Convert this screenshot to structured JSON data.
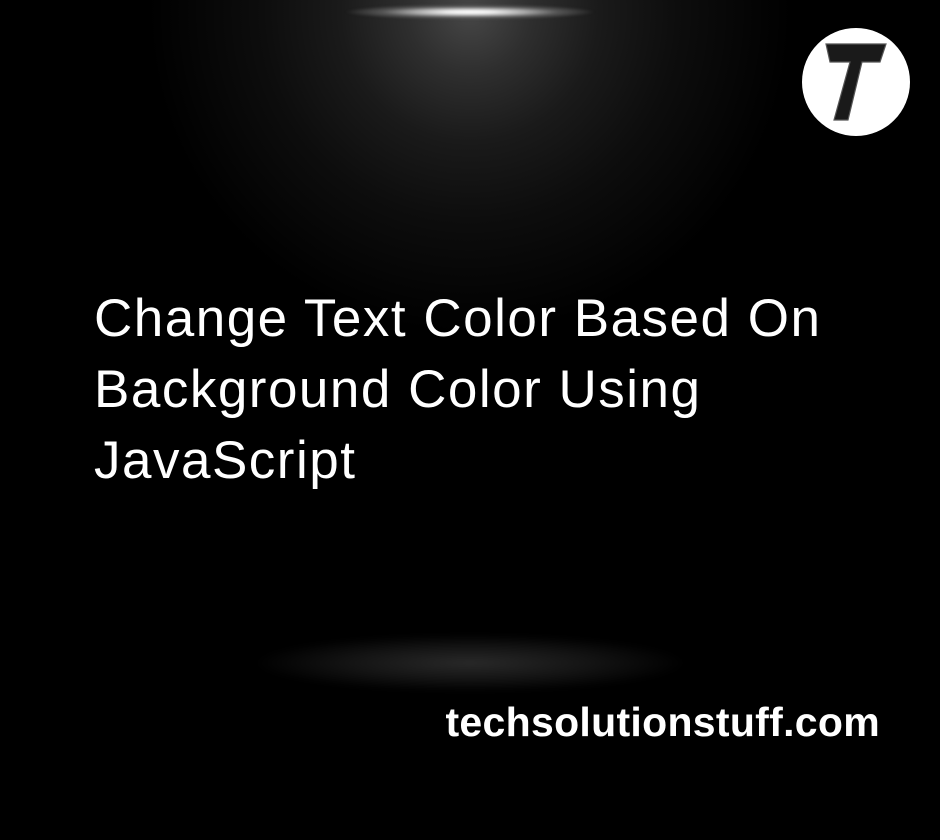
{
  "heading": "Change Text Color Based On Background Color Using JavaScript",
  "website": "techsolutionstuff.com",
  "logo": {
    "letter": "T"
  }
}
